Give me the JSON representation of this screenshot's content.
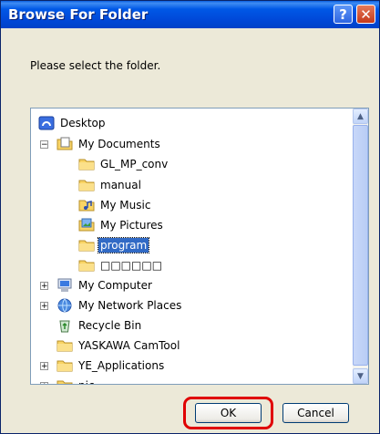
{
  "window": {
    "title": "Browse For Folder",
    "help_glyph": "?",
    "close_glyph": "✕"
  },
  "prompt": "Please select the folder.",
  "tree": {
    "items": [
      {
        "label": "Desktop",
        "icon": "desktop-icon"
      },
      {
        "label": "My Documents",
        "icon": "documents-icon",
        "expander": "−"
      },
      {
        "label": "GL_MP_conv",
        "icon": "folder-icon"
      },
      {
        "label": "manual",
        "icon": "folder-icon"
      },
      {
        "label": "My Music",
        "icon": "music-folder-icon"
      },
      {
        "label": "My Pictures",
        "icon": "pictures-folder-icon"
      },
      {
        "label": "program",
        "icon": "folder-icon",
        "selected": true
      },
      {
        "label": "□□□□□□",
        "icon": "folder-icon"
      },
      {
        "label": "My Computer",
        "icon": "computer-icon",
        "expander": "+"
      },
      {
        "label": "My Network Places",
        "icon": "network-icon",
        "expander": "+"
      },
      {
        "label": "Recycle Bin",
        "icon": "recycle-bin-icon"
      },
      {
        "label": "YASKAWA CamTool",
        "icon": "folder-icon"
      },
      {
        "label": "YE_Applications",
        "icon": "folder-icon",
        "expander": "+"
      },
      {
        "label": "pic",
        "icon": "folder-icon",
        "expander": "+"
      }
    ],
    "scroll_up_glyph": "▲",
    "scroll_down_glyph": "▼"
  },
  "buttons": {
    "ok": "OK",
    "cancel": "Cancel"
  },
  "colors": {
    "title_bar": "#0058E6",
    "selection": "#316AC5",
    "highlight_ring": "#E00000"
  }
}
